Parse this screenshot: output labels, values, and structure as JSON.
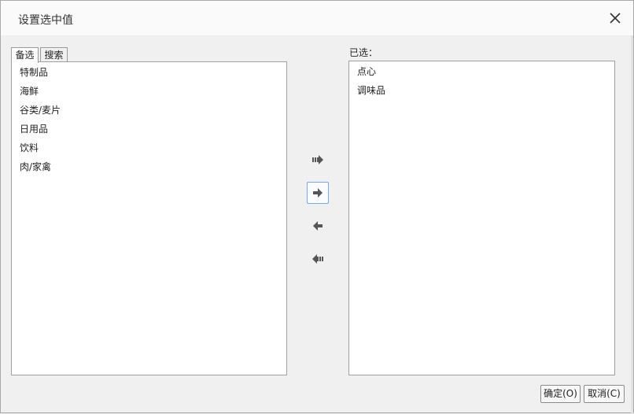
{
  "dialog": {
    "title": "设置选中值"
  },
  "tabs": [
    {
      "label": "备选",
      "active": true
    },
    {
      "label": "搜索",
      "active": false
    }
  ],
  "available": {
    "items": [
      "特制品",
      "海鲜",
      "谷类/麦片",
      "日用品",
      "饮料",
      "肉/家禽"
    ]
  },
  "selected": {
    "label": "已选：",
    "items": [
      "点心",
      "调味品"
    ]
  },
  "buttons": {
    "ok": "确定(O)",
    "cancel": "取消(C)"
  },
  "icons": {
    "close": "close-icon",
    "move_all_right": "double-arrow-right-icon",
    "move_right": "arrow-right-icon",
    "move_left": "arrow-left-icon",
    "move_all_left": "double-arrow-left-icon"
  },
  "colors": {
    "focus_border": "#7aa7e0",
    "arrow_fill": "#555555"
  }
}
